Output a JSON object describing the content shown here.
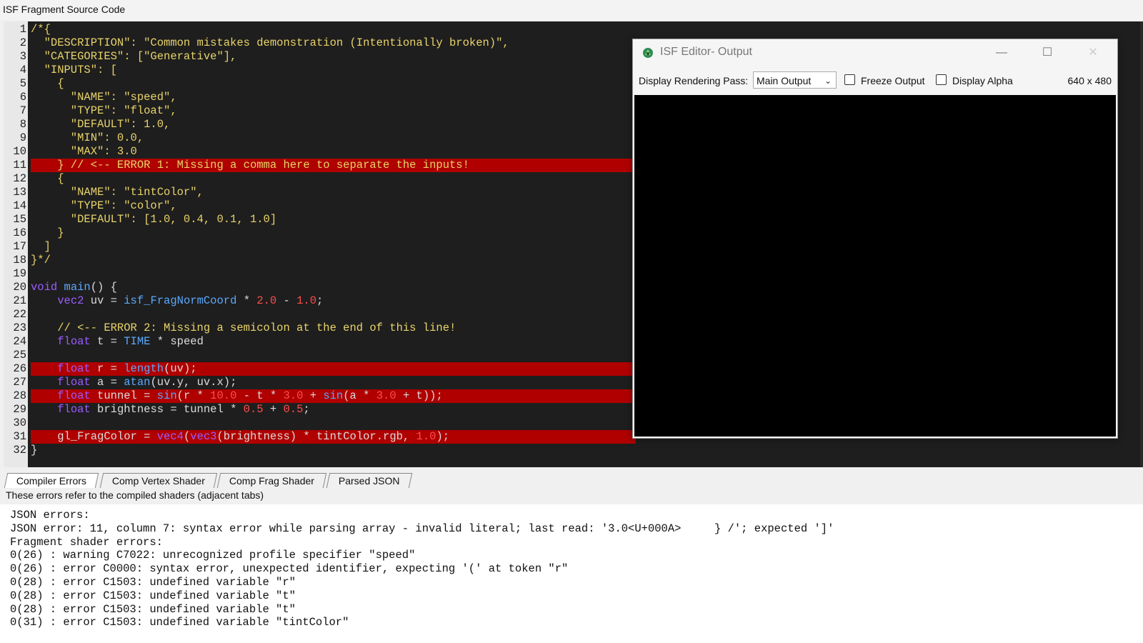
{
  "window": {
    "title": "ISF Fragment Source Code"
  },
  "editor": {
    "lines": [
      {
        "n": "1",
        "text": "/*{"
      },
      {
        "n": "2",
        "text": "  \"DESCRIPTION\": \"Common mistakes demonstration (Intentionally broken)\","
      },
      {
        "n": "3",
        "text": "  \"CATEGORIES\": [\"Generative\"],"
      },
      {
        "n": "4",
        "text": "  \"INPUTS\": ["
      },
      {
        "n": "5",
        "text": "    {"
      },
      {
        "n": "6",
        "text": "      \"NAME\": \"speed\","
      },
      {
        "n": "7",
        "text": "      \"TYPE\": \"float\","
      },
      {
        "n": "8",
        "text": "      \"DEFAULT\": 1.0,"
      },
      {
        "n": "9",
        "text": "      \"MIN\": 0.0,"
      },
      {
        "n": "10",
        "text": "      \"MAX\": 3.0"
      },
      {
        "n": "11",
        "text": "    } // <-- ERROR 1: Missing a comma here to separate the inputs!",
        "error": true
      },
      {
        "n": "12",
        "text": "    {"
      },
      {
        "n": "13",
        "text": "      \"NAME\": \"tintColor\","
      },
      {
        "n": "14",
        "text": "      \"TYPE\": \"color\","
      },
      {
        "n": "15",
        "text": "      \"DEFAULT\": [1.0, 0.4, 0.1, 1.0]"
      },
      {
        "n": "16",
        "text": "    }"
      },
      {
        "n": "17",
        "text": "  ]"
      },
      {
        "n": "18",
        "text": "}*/"
      },
      {
        "n": "19",
        "text": ""
      },
      {
        "n": "20",
        "text": "void main() {"
      },
      {
        "n": "21",
        "text": "    vec2 uv = isf_FragNormCoord * 2.0 - 1.0;"
      },
      {
        "n": "22",
        "text": ""
      },
      {
        "n": "23",
        "text": "    // <-- ERROR 2: Missing a semicolon at the end of this line!"
      },
      {
        "n": "24",
        "text": "    float t = TIME * speed"
      },
      {
        "n": "25",
        "text": ""
      },
      {
        "n": "26",
        "text": "    float r = length(uv);",
        "error": true
      },
      {
        "n": "27",
        "text": "    float a = atan(uv.y, uv.x);"
      },
      {
        "n": "28",
        "text": "    float tunnel = sin(r * 10.0 - t * 3.0 + sin(a * 3.0 + t));",
        "error": true
      },
      {
        "n": "29",
        "text": "    float brightness = tunnel * 0.5 + 0.5;"
      },
      {
        "n": "30",
        "text": ""
      },
      {
        "n": "31",
        "text": "    gl_FragColor = vec4(vec3(brightness) * tintColor.rgb, 1.0);",
        "error": true
      },
      {
        "n": "32",
        "text": "}"
      }
    ]
  },
  "output_window": {
    "title": "ISF Editor- Output",
    "pass_label": "Display Rendering Pass:",
    "pass_value": "Main Output",
    "freeze_label": "Freeze Output",
    "alpha_label": "Display Alpha",
    "resolution": "640 x 480",
    "minimize": "—",
    "maximize": "☐",
    "close": "✕"
  },
  "tabs": [
    {
      "label": "Compiler Errors",
      "active": true
    },
    {
      "label": "Comp Vertex Shader"
    },
    {
      "label": "Comp Frag Shader"
    },
    {
      "label": "Parsed JSON"
    }
  ],
  "console": {
    "subtitle": "These errors refer to the compiled shaders (adjacent tabs)",
    "lines": [
      "JSON errors:",
      "JSON error: 11, column 7: syntax error while parsing array - invalid literal; last read: '3.0<U+000A>     } /'; expected ']'",
      "Fragment shader errors:",
      "0(26) : warning C7022: unrecognized profile specifier \"speed\"",
      "0(26) : error C0000: syntax error, unexpected identifier, expecting '(' at token \"r\"",
      "0(28) : error C1503: undefined variable \"r\"",
      "0(28) : error C1503: undefined variable \"t\"",
      "0(28) : error C1503: undefined variable \"t\"",
      "0(31) : error C1503: undefined variable \"tintColor\""
    ]
  },
  "colors": {
    "error_line": "#b00000",
    "editor_bg": "#1e1e1e"
  }
}
